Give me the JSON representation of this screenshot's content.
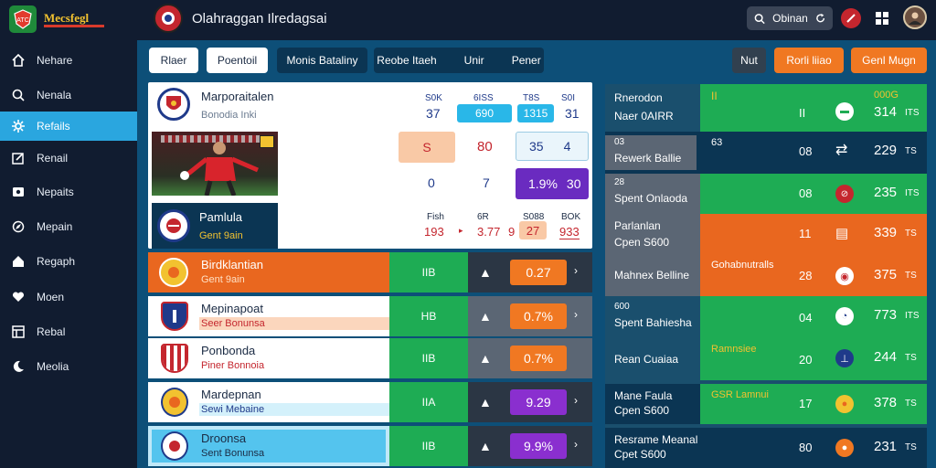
{
  "app": {
    "logo_text": "Mecsfegl",
    "title": "Olahraggan Ilredagsai"
  },
  "search": {
    "value": "Obinan"
  },
  "sidebar": {
    "items": [
      {
        "label": "Nehare",
        "icon": "home-icon"
      },
      {
        "label": "Nenala",
        "icon": "search-icon"
      },
      {
        "label": "Refails",
        "icon": "gear-icon"
      },
      {
        "label": "Renail",
        "icon": "edit-icon"
      },
      {
        "label": "Nepaits",
        "icon": "photo-icon"
      },
      {
        "label": "Mepain",
        "icon": "compass-icon"
      },
      {
        "label": "Regaph",
        "icon": "home-icon"
      },
      {
        "label": "Moen",
        "icon": "heart-icon"
      },
      {
        "label": "Rebal",
        "icon": "table-icon"
      },
      {
        "label": "Meolia",
        "icon": "moon-icon"
      }
    ]
  },
  "toolbar": {
    "tab_a": "Rlaer",
    "tab_b": "Poentoil",
    "tab_c": "Monis Bataliny",
    "tab_d": [
      "Reobe Itaeh",
      "Unir",
      "Pener"
    ],
    "right_a": "Nut",
    "right_b": "Rorli liiao",
    "right_c": "Genl Mugn"
  },
  "featured": {
    "team_a": {
      "name": "Marporaitalen",
      "sub": "Bonodia Inki"
    },
    "team_b": {
      "name": "Pamlula",
      "sub": "Gent 9ain"
    },
    "odds_top": {
      "headers": [
        "S0K",
        "6ISS",
        "T8S",
        "S0I"
      ],
      "values": [
        "37",
        "690",
        "1315",
        "31"
      ]
    },
    "odds_mid": [
      "S",
      "80",
      "35",
      "4"
    ],
    "odds_low": [
      "0",
      "7",
      "1.9%",
      "30"
    ],
    "odds_bot": {
      "headers": [
        "Fish",
        "6R",
        "S088",
        "BOK"
      ],
      "values": [
        "193",
        "3.77",
        "9",
        "27",
        "933"
      ]
    }
  },
  "matches": [
    {
      "name": "Birdklantian",
      "sub": "Gent 9ain",
      "code": "IIB",
      "odds": "0.27",
      "bg": "#e9671f",
      "pill": "#f07822",
      "crest": "#e9671f"
    },
    {
      "name": "Mepinapoat",
      "sub": "Seer Bonunsa",
      "code": "HB",
      "odds": "0.7%",
      "bg": "#ffffff",
      "pill": "#f07822",
      "crest": "#1f3a8a"
    },
    {
      "name": "Ponbonda",
      "sub": "Piner Bonnoia",
      "code": "IIB",
      "odds": "0.7%",
      "bg": "#ffffff",
      "pill": "#f07822",
      "crest": "#c4262e"
    },
    {
      "name": "Mardepnan",
      "sub": "Sewi Mebaine",
      "code": "IIA",
      "odds": "9.29",
      "bg": "#ffffff",
      "pill": "#8a2fcf",
      "crest": "#e9671f"
    },
    {
      "name": "Droonsa",
      "sub": "Sent Bonunsa",
      "code": "IIB",
      "odds": "9.9%",
      "bg": "#bfe8f8",
      "pill": "#8a2fcf",
      "crest": "#1f3a8a"
    }
  ],
  "right_rows": [
    {
      "title": "Rnerodon",
      "sub": "Naer 0AIRR",
      "badge": "II",
      "mid": "II",
      "value": "314",
      "unit": "ITS",
      "top": "000G"
    },
    {
      "title": "03",
      "sub": "Rewerk Ballie",
      "badge": "63",
      "mid": "08",
      "value": "229",
      "unit": "TS"
    },
    {
      "title": "28",
      "sub": "Spent Onlaoda",
      "badge": "",
      "mid": "08",
      "value": "235",
      "unit": "ITS"
    },
    {
      "title": "Parlanlan",
      "sub": "Cpen S600",
      "badge": "",
      "mid": "11",
      "value": "339",
      "unit": "TS"
    },
    {
      "title": "Mahnex Belline",
      "sub": "",
      "badge": "Gohabnutralls",
      "mid": "28",
      "value": "375",
      "unit": "TS"
    },
    {
      "title": "600",
      "sub": "Spent Bahiesha",
      "badge": "",
      "mid": "04",
      "value": "773",
      "unit": "ITS"
    },
    {
      "title": "Rean Cuaiaa",
      "sub": "",
      "badge": "Ramnsiee",
      "mid": "20",
      "value": "244",
      "unit": "TS"
    },
    {
      "title": "Mane Faula",
      "sub": "Cpen S600",
      "badge": "GSR Lamnui",
      "mid": "17",
      "value": "378",
      "unit": "TS"
    },
    {
      "title": "Resrame Meanal",
      "sub": "Cpet S600",
      "badge": "",
      "mid": "80",
      "value": "231",
      "unit": "TS"
    }
  ]
}
